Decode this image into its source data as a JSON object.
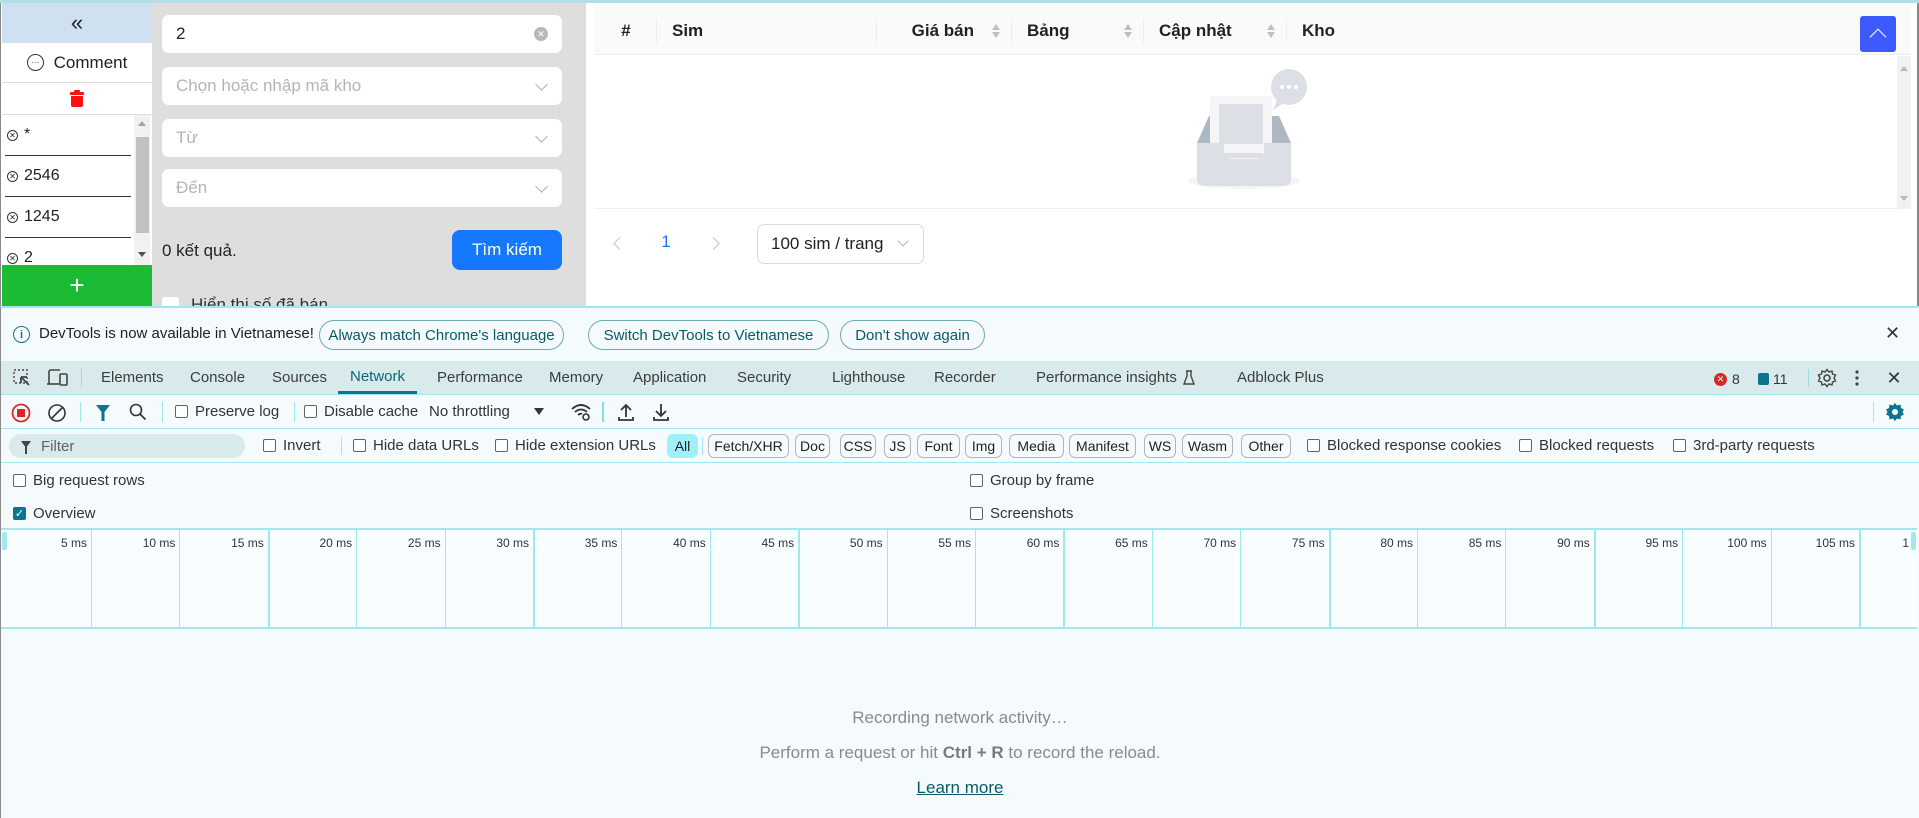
{
  "app": {
    "sidebar": {
      "collapse_icon": "double-chevron-left",
      "comment_label": "Comment",
      "comment_icon": "comment-bubble",
      "trash_icon": "trash-can",
      "trash_color": "#ff1010",
      "sim_items": [
        "*",
        "2546",
        "1245",
        "2"
      ],
      "add_label": "+",
      "add_color": "#1bbc34"
    },
    "filters": {
      "sim_value": "2",
      "warehouse_placeholder": "Chọn hoặc nhập mã kho",
      "from_placeholder": "Từ",
      "to_placeholder": "Đến",
      "result_count": "0 kết quả.",
      "search_label": "Tìm kiếm",
      "search_color": "#1677ff",
      "show_sold_label": "Hiển thị số đã bán"
    },
    "table": {
      "columns": [
        {
          "label": "#",
          "sortable": false
        },
        {
          "label": "Sim",
          "sortable": false
        },
        {
          "label": "Giá bán",
          "sortable": true
        },
        {
          "label": "Bảng",
          "sortable": true
        },
        {
          "label": "Cập nhật",
          "sortable": true
        },
        {
          "label": "Kho",
          "sortable": false
        }
      ],
      "rows": [],
      "empty_icon": "empty-inbox"
    },
    "pagination": {
      "current_page": "1",
      "page_size": "100 sim / trang"
    },
    "scroll_top_color": "#3d5afe"
  },
  "devtools": {
    "notice": {
      "message": "DevTools is now available in Vietnamese!",
      "buttons": [
        "Always match Chrome's language",
        "Switch DevTools to Vietnamese",
        "Don't show again"
      ],
      "close": "✕"
    },
    "tabs": [
      "Elements",
      "Console",
      "Sources",
      "Network",
      "Performance",
      "Memory",
      "Application",
      "Security",
      "Lighthouse",
      "Recorder",
      "Performance insights",
      "Adblock Plus"
    ],
    "active_tab": "Network",
    "errors_count": "8",
    "messages_count": "11",
    "toolbar": {
      "preserve_log": "Preserve log",
      "disable_cache": "Disable cache",
      "throttling": "No throttling"
    },
    "filter": {
      "placeholder": "Filter",
      "invert": "Invert",
      "hide_data_urls": "Hide data URLs",
      "hide_extension_urls": "Hide extension URLs",
      "types": [
        "All",
        "Fetch/XHR",
        "Doc",
        "CSS",
        "JS",
        "Font",
        "Img",
        "Media",
        "Manifest",
        "WS",
        "Wasm",
        "Other"
      ],
      "active_type": "All",
      "blocked_response_cookies": "Blocked response cookies",
      "blocked_requests": "Blocked requests",
      "third_party_requests": "3rd-party requests"
    },
    "options": {
      "big_request_rows": {
        "label": "Big request rows",
        "checked": false
      },
      "overview": {
        "label": "Overview",
        "checked": true
      },
      "group_by_frame": {
        "label": "Group by frame",
        "checked": false
      },
      "screenshots": {
        "label": "Screenshots",
        "checked": false
      }
    },
    "timeline_ticks": [
      "5 ms",
      "10 ms",
      "15 ms",
      "20 ms",
      "25 ms",
      "30 ms",
      "35 ms",
      "40 ms",
      "45 ms",
      "50 ms",
      "55 ms",
      "60 ms",
      "65 ms",
      "70 ms",
      "75 ms",
      "80 ms",
      "85 ms",
      "90 ms",
      "95 ms",
      "100 ms",
      "105 ms",
      "1"
    ],
    "empty": {
      "line1": "Recording network activity…",
      "line2_pre": "Perform a request or hit ",
      "line2_key": "Ctrl + R",
      "line2_post": " to record the reload.",
      "learn_more": "Learn more"
    }
  }
}
